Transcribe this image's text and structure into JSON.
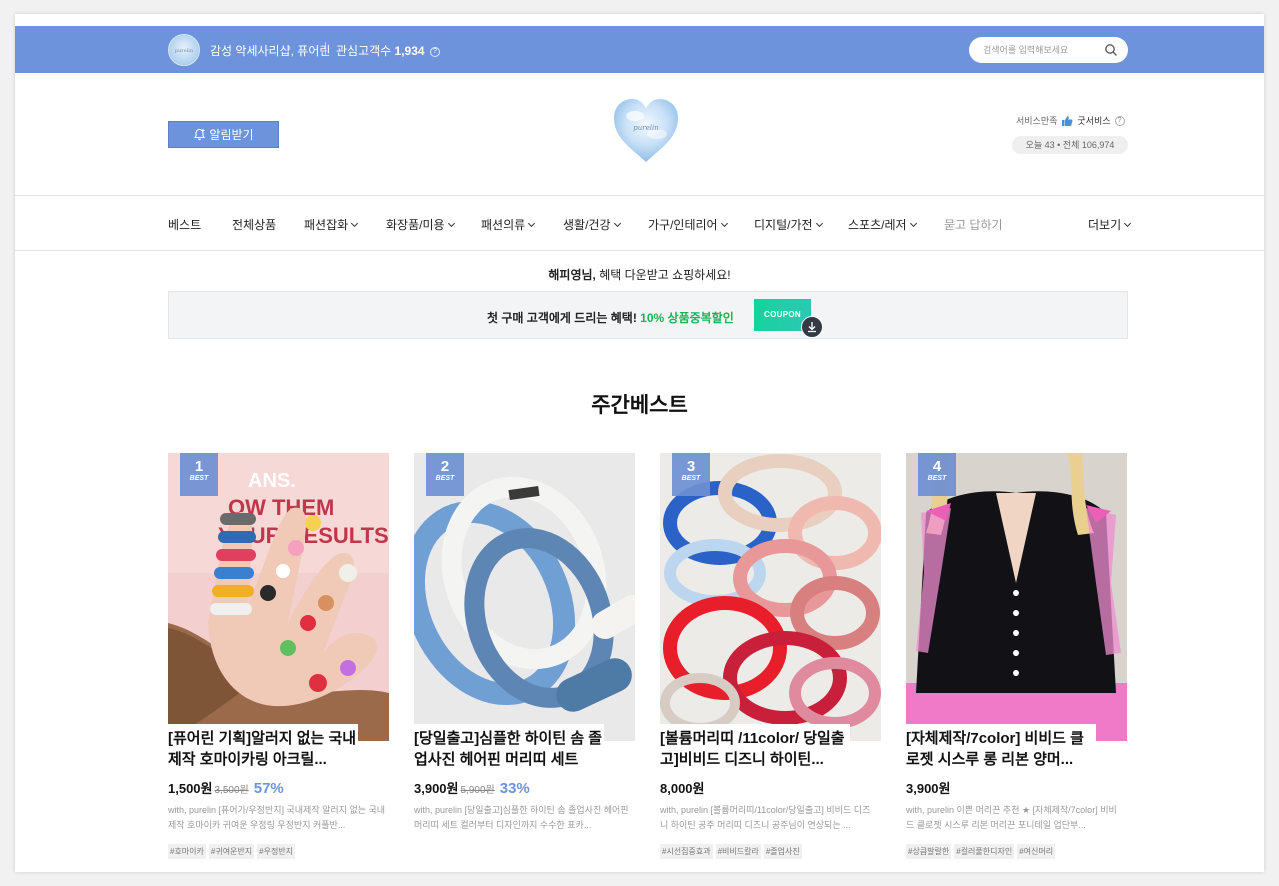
{
  "header": {
    "avatar_text": "purelin",
    "shop_name": "감성 악세사리샵, 퓨어린",
    "visitors_label": "관심고객수",
    "visitors_count": "1,934",
    "search_placeholder": "검색어를 입력해보세요"
  },
  "brand": {
    "notify_label": "알림받기",
    "logo_text": "purelin",
    "service_label": "서비스만족",
    "service_value": "굿서비스",
    "today_total": "오늘 43 • 전체 106,974"
  },
  "nav": {
    "items": [
      {
        "label": "베스트"
      },
      {
        "label": "전체상품"
      },
      {
        "label": "패션잡화"
      },
      {
        "label": "화장품/미용"
      },
      {
        "label": "패션의류"
      },
      {
        "label": "생활/건강"
      },
      {
        "label": "가구/인테리어"
      },
      {
        "label": "디지털/가전"
      },
      {
        "label": "스포츠/레저"
      },
      {
        "label": "묻고 답하기"
      },
      {
        "label": "더보기"
      }
    ]
  },
  "greeting": {
    "name": "해피영님,",
    "text": " 혜택 다운받고 쇼핑하세요!"
  },
  "banner": {
    "text": "첫 구매 고객에게 드리는 혜택!",
    "highlight": "10% 상품중복할인",
    "coupon_label": "COUPON"
  },
  "section_title": "주간베스트",
  "products": [
    {
      "rank": "1",
      "badge": "BEST",
      "title": "[퓨어린 기획]알러지 없는 국내제작 호마이카링 아크릴...",
      "price": "1,500원",
      "original": "3,500원",
      "discount": "57%",
      "desc": "with, purelin [퓨어가/우정반지] 국내제작 알러지 없는 국내제작 호마이카 귀여운 우정링 우정반지 커플반...",
      "tags": [
        "#호마이카",
        "#귀여운반지",
        "#우정반지"
      ]
    },
    {
      "rank": "2",
      "badge": "BEST",
      "title": "[당일출고]심플한 하이틴 솜 졸업사진 헤어핀 머리띠 세트",
      "price": "3,900원",
      "original": "5,900원",
      "discount": "33%",
      "desc": "with, purelin [당일출고]심플한 하이틴 솜 졸업사진 헤어핀 머리띠 세트 컬러부터 디자인까지 수수한 표카...",
      "tags": []
    },
    {
      "rank": "3",
      "badge": "BEST",
      "title": "[볼륨머리띠 /11color/ 당일출고]비비드 디즈니 하이틴...",
      "price": "8,000원",
      "original": "",
      "discount": "",
      "desc": "with, purelin [볼륨머리띠/11color/당일출고] 비비드 디즈니 하이틴 공주 머리띠 디즈니 공주님이 연상되는 ...",
      "tags": [
        "#시선집중효과",
        "#비비드칼라",
        "#졸업사진"
      ]
    },
    {
      "rank": "4",
      "badge": "BEST",
      "title": "[자체제작/7color] 비비드 클로젯 시스루 롱 리본 양머...",
      "price": "3,900원",
      "original": "",
      "discount": "",
      "desc": "with, purelin 이쁜 머리끈 추천 ★ [자체제작/7color] 비비드 클로젯 시스루 리본 머리끈 포니테일 업단부...",
      "tags": [
        "#상큼발랄한",
        "#컬러풀한디자인",
        "#여신머리"
      ]
    }
  ],
  "colors": {
    "accent": "#6d93dc",
    "green": "#1db355"
  }
}
